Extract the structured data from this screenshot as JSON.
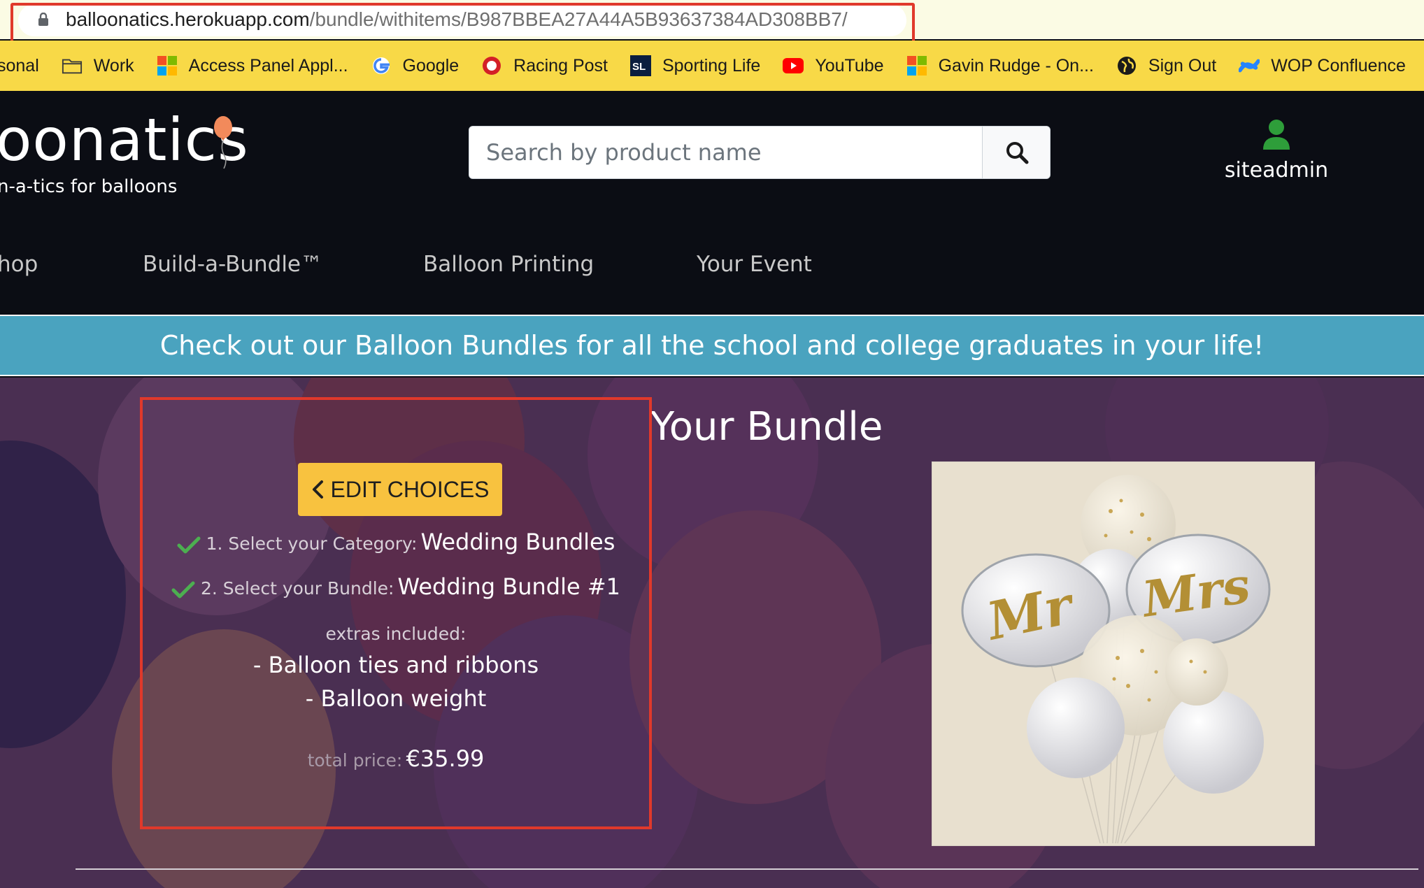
{
  "browser": {
    "url_host": "balloonatics.herokuapp.com",
    "url_path": "/bundle/withitems/B987BBEA27A44A5B93637384AD308BB7/"
  },
  "bookmarks": [
    {
      "label": "sonal",
      "icon": "none"
    },
    {
      "label": "Work",
      "icon": "folder-icon"
    },
    {
      "label": "Access Panel Appl...",
      "icon": "microsoft-icon"
    },
    {
      "label": "Google",
      "icon": "google-icon"
    },
    {
      "label": "Racing Post",
      "icon": "racing-post-icon"
    },
    {
      "label": "Sporting Life",
      "icon": "sporting-life-icon"
    },
    {
      "label": "YouTube",
      "icon": "youtube-icon"
    },
    {
      "label": "Gavin Rudge - On...",
      "icon": "microsoft-icon"
    },
    {
      "label": "Sign Out",
      "icon": "globe-icon"
    },
    {
      "label": "WOP Confluence",
      "icon": "confluence-icon"
    }
  ],
  "header": {
    "logo_text": "oonatics",
    "tagline": "n-a-tics for balloons",
    "search_placeholder": "Search by product name",
    "username": "siteadmin"
  },
  "nav": {
    "items": [
      "hop",
      "Build-a-Bundle™",
      "Balloon Printing",
      "Your Event"
    ]
  },
  "promo": {
    "text": "Check out our Balloon Bundles for all the school and college graduates in your life!"
  },
  "bundle": {
    "title": "Your Bundle",
    "edit_label": "EDIT CHOICES",
    "step1_label": "1. Select your Category:",
    "step1_value": "Wedding Bundles",
    "step2_label": "2. Select your Bundle:",
    "step2_value": "Wedding Bundle #1",
    "extras_label": "extras included:",
    "extras": [
      "- Balloon ties and ribbons",
      "- Balloon weight"
    ],
    "total_label": "total price:",
    "total_value": "€35.99",
    "image_text": [
      "Mr",
      "Mrs"
    ]
  },
  "colors": {
    "bookmarks_bg": "#f8d947",
    "header_bg": "#0b0d14",
    "promo_bg": "#4aa3bf",
    "hero_bg": "#4a2f52",
    "edit_button": "#f8c23f",
    "check_green": "#4caf50",
    "highlight_red": "#e0392b",
    "user_icon": "#2e9e3a"
  }
}
